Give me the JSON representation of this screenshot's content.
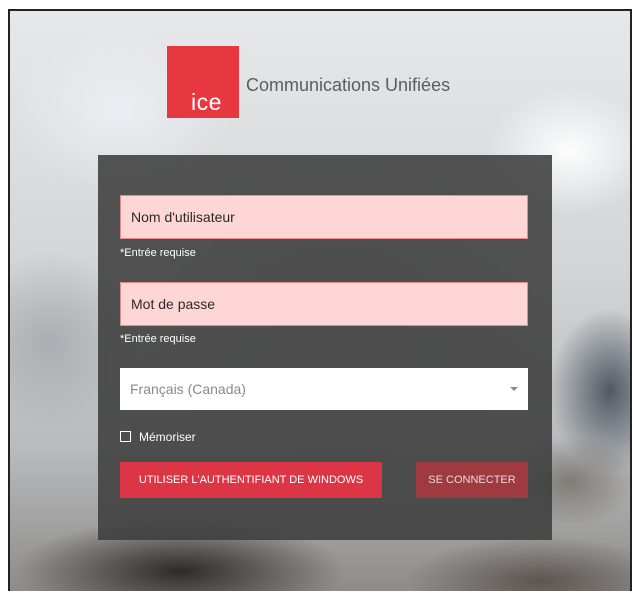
{
  "brand": {
    "logo_text": "ice",
    "title": "Communications Unifiées",
    "accent_color": "#e8383f"
  },
  "form": {
    "username": {
      "placeholder": "Nom d'utilisateur",
      "value": "",
      "requirement_text": "*Entrée requise"
    },
    "password": {
      "placeholder": "Mot de passe",
      "value": "",
      "requirement_text": "*Entrée requise"
    },
    "language": {
      "selected": "Français (Canada)",
      "icon": "caret-down-icon"
    },
    "remember": {
      "label": "Mémoriser",
      "checked": false
    },
    "buttons": {
      "windows_auth": "UTILISER L'AUTHENTIFIANT DE WINDOWS",
      "login": "SE CONNECTER"
    }
  }
}
